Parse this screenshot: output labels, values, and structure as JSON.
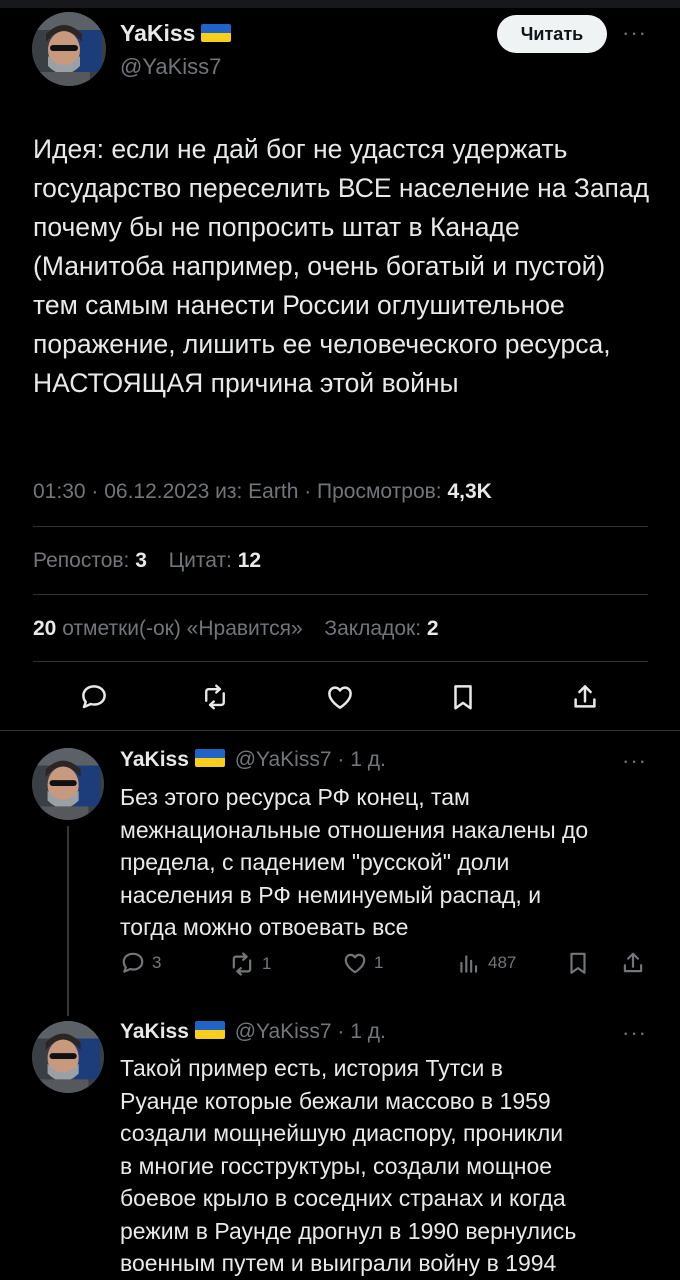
{
  "main_tweet": {
    "author_name": "YaKiss",
    "handle": "@YaKiss7",
    "follow_button": "Читать",
    "text": "Идея: если не дай бог не удастся удержать государство переселить ВСЕ население на Запад почему бы не попросить штат в Канаде (Манитоба например, очень богатый и пустой) тем самым нанести России оглушительное поражение, лишить ее человеческого ресурса, НАСТОЯЩАЯ причина этой войны",
    "meta_prefix": "01:30 · 06.12.2023 из: Earth · Просмотров: ",
    "views": "4,3K",
    "reposts_label": "Репостов: ",
    "reposts": "3",
    "quotes_label": "Цитат: ",
    "quotes": "12",
    "likes": "20",
    "likes_label": " отметки(-ок) «Нравится»",
    "bookmarks_label": "Закладок: ",
    "bookmarks": "2"
  },
  "replies": [
    {
      "author_name": "YaKiss",
      "handle_time": "@YaKiss7 · 1 д.",
      "text": "Без этого ресурса РФ конец, там\nмежнациональные отношения накалены до\nпредела, с падением \"русской\" доли\nнаселения в РФ неминуемый распад, и\nтогда можно отвоевать все",
      "replies_count": "3",
      "reposts_count": "1",
      "likes_count": "1",
      "views_count": "487"
    },
    {
      "author_name": "YaKiss",
      "handle_time": "@YaKiss7 · 1 д.",
      "text": "Такой пример есть, история Тутси в\nРуанде которые бежали массово в 1959\nсоздали мощнейшую диаспору, проникли\nв многие госструктуры, создали мощное\nбоевое крыло в соседних странах и когда\nрежим в Раунде дрогнул в 1990 вернулись\nвоенным путем и выиграли войну в 1994"
    }
  ],
  "colors": {
    "background": "#000000",
    "text": "#e7e9ea",
    "muted": "#71767b",
    "divider": "#2f3336",
    "flag_blue": "#1f63c6",
    "flag_yellow": "#f5cf19"
  },
  "icons": [
    "reply-icon",
    "repost-icon",
    "like-icon",
    "bookmark-icon",
    "share-icon",
    "views-icon",
    "more-icon",
    "flag-ukraine-icon"
  ]
}
